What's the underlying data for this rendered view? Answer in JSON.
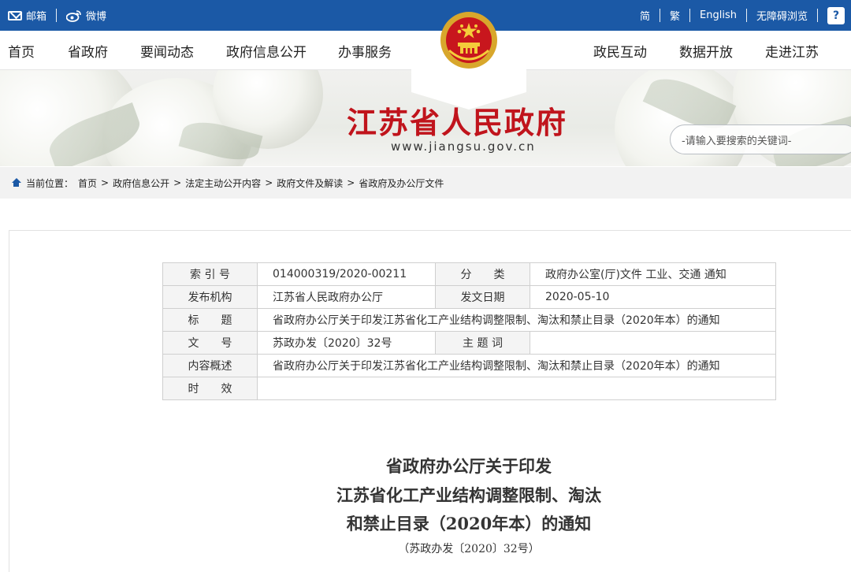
{
  "topbar": {
    "mail": "邮箱",
    "weibo": "微博",
    "simplified": "简",
    "traditional": "繁",
    "english": "English",
    "accessible": "无障碍浏览"
  },
  "nav": {
    "items": [
      "首页",
      "省政府",
      "要闻动态",
      "政府信息公开",
      "办事服务",
      "政民互动",
      "数据开放",
      "走进江苏"
    ]
  },
  "banner": {
    "title": "江苏省人民政府",
    "url": "www.jiangsu.gov.cn",
    "search_placeholder": "-请输入要搜索的关键词-"
  },
  "breadcrumb": {
    "label": "当前位置：",
    "items": [
      "首页",
      "政府信息公开",
      "法定主动公开内容",
      "政府文件及解读",
      "省政府及办公厅文件"
    ]
  },
  "meta": {
    "index_label": "索 引 号",
    "index_value": "014000319/2020-00211",
    "category_label": "分　　类",
    "category_value": "政府办公室(厅)文件 工业、交通 通知",
    "issuer_label": "发布机构",
    "issuer_value": "江苏省人民政府办公厅",
    "date_label": "发文日期",
    "date_value": "2020-05-10",
    "title_label": "标　　题",
    "title_value": "省政府办公厅关于印发江苏省化工产业结构调整限制、淘汰和禁止目录（2020年本）的通知",
    "docno_label": "文　　号",
    "docno_value": "苏政办发〔2020〕32号",
    "subject_label": "主 题 词",
    "subject_value": "",
    "summary_label": "内容概述",
    "summary_value": "省政府办公厅关于印发江苏省化工产业结构调整限制、淘汰和禁止目录（2020年本）的通知",
    "validity_label": "时　　效",
    "validity_value": ""
  },
  "document": {
    "title_line1": "省政府办公厅关于印发",
    "title_line2": "江苏省化工产业结构调整限制、淘汰",
    "title_line3": "和禁止目录（2020年本）的通知",
    "number": "（苏政办发〔2020〕32号）"
  },
  "colors": {
    "topbar": "#1b59a6",
    "title_red": "#c0141c"
  }
}
